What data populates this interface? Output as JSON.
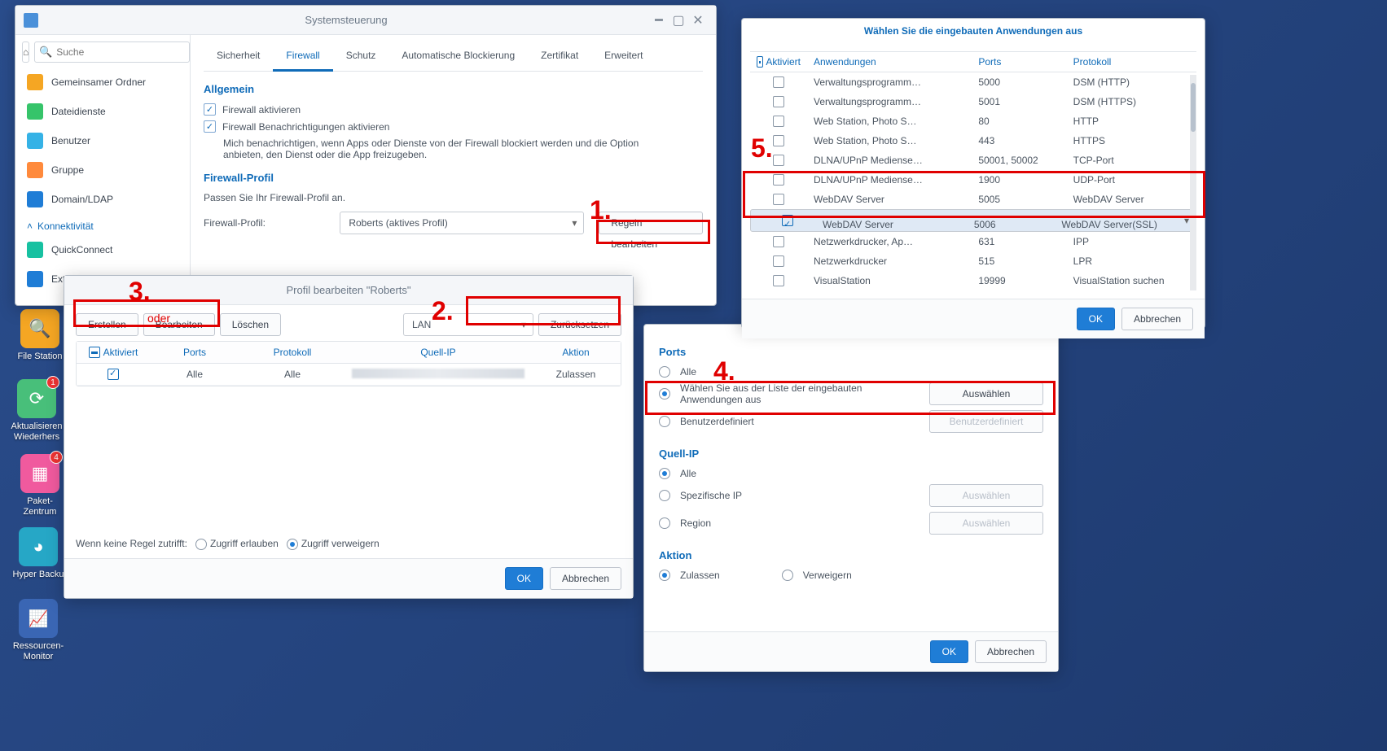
{
  "desktop": {
    "fileStation": "File Station",
    "updater": "Aktualisieren Wiederhers",
    "updater_badge": "1",
    "pkg": "Paket-Zentrum",
    "pkg_badge": "4",
    "backup": "Hyper Backu",
    "monitor": "Ressourcen-Monitor"
  },
  "cp": {
    "title": "Systemsteuerung",
    "search_placeholder": "Suche",
    "side": {
      "shared": "Gemeinsamer Ordner",
      "filesvc": "Dateidienste",
      "user": "Benutzer",
      "group": "Gruppe",
      "domain": "Domain/LDAP",
      "cat": "Konnektivität",
      "qc": "QuickConnect",
      "ext": "Ext"
    },
    "tabs": {
      "security": "Sicherheit",
      "firewall": "Firewall",
      "protect": "Schutz",
      "autoblock": "Automatische Blockierung",
      "cert": "Zertifikat",
      "advanced": "Erweitert"
    },
    "general": "Allgemein",
    "cb1": "Firewall aktivieren",
    "cb2": "Firewall Benachrichtigungen aktivieren",
    "desc": "Mich benachrichtigen, wenn Apps oder Dienste von der Firewall blockiert werden und die Option anbieten, den Dienst oder die App freizugeben.",
    "profile_h": "Firewall-Profil",
    "profile_d": "Passen Sie Ihr Firewall-Profil an.",
    "profile_lbl": "Firewall-Profil:",
    "profile_val": "Roberts (aktives Profil)",
    "edit_rules": "Regeln bearbeiten"
  },
  "pe": {
    "title": "Profil bearbeiten \"Roberts\"",
    "create": "Erstellen",
    "edit": "Bearbeiten",
    "delete": "Löschen",
    "iface": "LAN",
    "reset": "Zurücksetzen",
    "hdr": {
      "enabled": "Aktiviert",
      "ports": "Ports",
      "proto": "Protokoll",
      "src": "Quell-IP",
      "action": "Aktion"
    },
    "row": {
      "ports": "Alle",
      "proto": "Alle",
      "src": "",
      "action": "Zulassen"
    },
    "norule": "Wenn keine Regel zutrifft:",
    "allow": "Zugriff erlauben",
    "deny": "Zugriff verweigern",
    "ok": "OK",
    "cancel": "Abbrechen"
  },
  "rl": {
    "ports_h": "Ports",
    "all": "Alle",
    "fromlist": "Wählen Sie aus der Liste der eingebauten Anwendungen aus",
    "select": "Auswählen",
    "custom": "Benutzerdefiniert",
    "custom_btn": "Benutzerdefiniert",
    "src_h": "Quell-IP",
    "specific": "Spezifische IP",
    "region": "Region",
    "action_h": "Aktion",
    "allow": "Zulassen",
    "deny": "Verweigern",
    "ok": "OK",
    "cancel": "Abbrechen"
  },
  "ap": {
    "title": "Wählen Sie die eingebauten Anwendungen aus",
    "hdr": {
      "enabled": "Aktiviert",
      "app": "Anwendungen",
      "ports": "Ports",
      "proto": "Protokoll"
    },
    "rows": [
      {
        "app": "Verwaltungsprogramm…",
        "ports": "5000",
        "proto": "DSM (HTTP)",
        "chk": false
      },
      {
        "app": "Verwaltungsprogramm…",
        "ports": "5001",
        "proto": "DSM (HTTPS)",
        "chk": false
      },
      {
        "app": "Web Station, Photo S…",
        "ports": "80",
        "proto": "HTTP",
        "chk": false
      },
      {
        "app": "Web Station, Photo S…",
        "ports": "443",
        "proto": "HTTPS",
        "chk": false
      },
      {
        "app": "DLNA/UPnP Mediense…",
        "ports": "50001, 50002",
        "proto": "TCP-Port",
        "chk": false
      },
      {
        "app": "DLNA/UPnP Mediense…",
        "ports": "1900",
        "proto": "UDP-Port",
        "chk": false
      },
      {
        "app": "WebDAV Server",
        "ports": "5005",
        "proto": "WebDAV Server",
        "chk": false
      },
      {
        "app": "WebDAV Server",
        "ports": "5006",
        "proto": "WebDAV Server(SSL)",
        "chk": true
      },
      {
        "app": "Netzwerkdrucker, Ap…",
        "ports": "631",
        "proto": "IPP",
        "chk": false
      },
      {
        "app": "Netzwerkdrucker",
        "ports": "515",
        "proto": "LPR",
        "chk": false
      },
      {
        "app": "VisualStation",
        "ports": "19999",
        "proto": "VisualStation suchen",
        "chk": false
      }
    ],
    "ok": "OK",
    "cancel": "Abbrechen"
  },
  "anno": {
    "n1": "1.",
    "n2": "2.",
    "n3": "3.",
    "n4": "4.",
    "n5": "5.",
    "oder": "oder"
  },
  "chart_data": {
    "type": "table",
    "title": "Wählen Sie die eingebauten Anwendungen aus",
    "columns": [
      "Aktiviert",
      "Anwendungen",
      "Ports",
      "Protokoll"
    ],
    "rows": [
      [
        false,
        "Verwaltungsprogramm…",
        "5000",
        "DSM (HTTP)"
      ],
      [
        false,
        "Verwaltungsprogramm…",
        "5001",
        "DSM (HTTPS)"
      ],
      [
        false,
        "Web Station, Photo S…",
        "80",
        "HTTP"
      ],
      [
        false,
        "Web Station, Photo S…",
        "443",
        "HTTPS"
      ],
      [
        false,
        "DLNA/UPnP Mediense…",
        "50001, 50002",
        "TCP-Port"
      ],
      [
        false,
        "DLNA/UPnP Mediense…",
        "1900",
        "UDP-Port"
      ],
      [
        false,
        "WebDAV Server",
        "5005",
        "WebDAV Server"
      ],
      [
        true,
        "WebDAV Server",
        "5006",
        "WebDAV Server(SSL)"
      ],
      [
        false,
        "Netzwerkdrucker, Ap…",
        "631",
        "IPP"
      ],
      [
        false,
        "Netzwerkdrucker",
        "515",
        "LPR"
      ],
      [
        false,
        "VisualStation",
        "19999",
        "VisualStation suchen"
      ]
    ]
  }
}
